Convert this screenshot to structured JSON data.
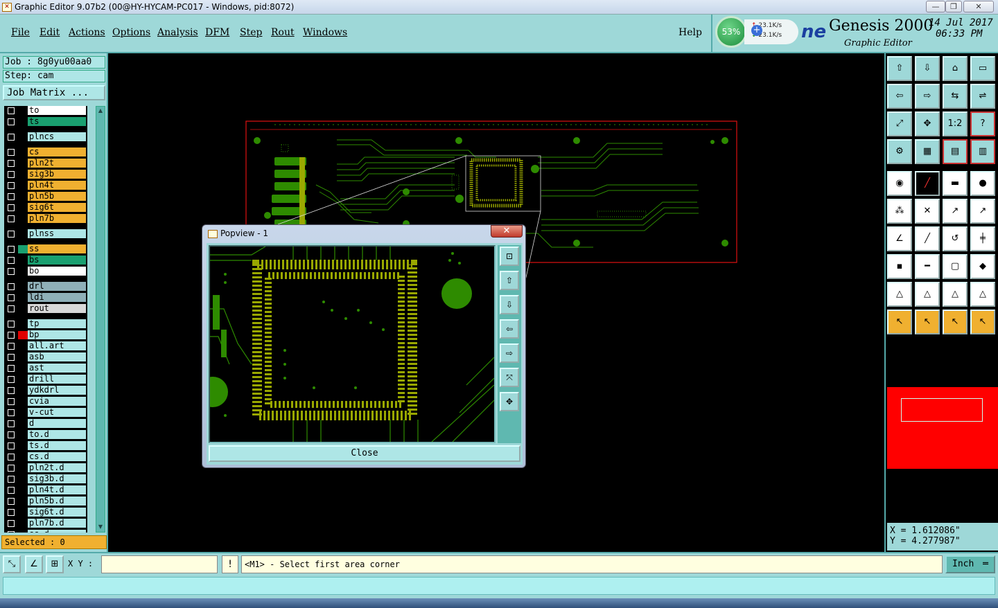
{
  "window": {
    "title": "Graphic Editor 9.07b2 (00@HY-HYCAM-PC017 - Windows, pid:8072)"
  },
  "menu": [
    "File",
    "Edit",
    "Actions",
    "Options",
    "Analysis",
    "DFM",
    "Step",
    "Rout",
    "Windows"
  ],
  "help_label": "Help",
  "brand": {
    "cpu": "53%",
    "net_up": "23.1K/s",
    "net_down": "23.1K/s",
    "logo_fragment": "ne",
    "product": "Genesis 2000",
    "subtitle": "Graphic Editor",
    "date": "14 Jul 2017",
    "time": "06:33 PM"
  },
  "job": {
    "job_line": "Job : 8g0yu00aa0",
    "step_line": "Step: cam",
    "matrix_label": "Job Matrix ..."
  },
  "colors": {
    "panel": "#9ed8d8",
    "board_green": "#2e8b00",
    "pad_olive": "#9aa800",
    "profile_red": "#e01010",
    "layer_orange": "#f0b030"
  },
  "layers": [
    {
      "name": "to",
      "color": "#ffffff"
    },
    {
      "name": "ts",
      "color": "#1aa070"
    },
    {
      "name": "plncs",
      "color": "#aee6e6"
    },
    {
      "name": "cs",
      "color": "#f0b030"
    },
    {
      "name": "pln2t",
      "color": "#f0b030"
    },
    {
      "name": "sig3b",
      "color": "#f0b030"
    },
    {
      "name": "pln4t",
      "color": "#f0b030"
    },
    {
      "name": "pln5b",
      "color": "#f0b030"
    },
    {
      "name": "sig6t",
      "color": "#f0b030"
    },
    {
      "name": "pln7b",
      "color": "#f0b030"
    },
    {
      "name": "plnss",
      "color": "#aee6e6"
    },
    {
      "name": "ss",
      "color": "#f0b030"
    },
    {
      "name": "bs",
      "color": "#1aa070"
    },
    {
      "name": "bo",
      "color": "#ffffff"
    },
    {
      "name": "drl",
      "color": "#8fb0b8"
    },
    {
      "name": "ldi",
      "color": "#8fb0b8"
    },
    {
      "name": "rout",
      "color": "#d8d8d8"
    },
    {
      "name": "tp",
      "color": "#aee6e6"
    },
    {
      "name": "bp",
      "color": "#aee6e6"
    },
    {
      "name": "all.art",
      "color": "#aee6e6"
    },
    {
      "name": "asb",
      "color": "#aee6e6"
    },
    {
      "name": "ast",
      "color": "#aee6e6"
    },
    {
      "name": "drill",
      "color": "#aee6e6"
    },
    {
      "name": "ydkdrl",
      "color": "#aee6e6"
    },
    {
      "name": "cvia",
      "color": "#aee6e6"
    },
    {
      "name": "v-cut",
      "color": "#aee6e6"
    },
    {
      "name": "d",
      "color": "#aee6e6"
    },
    {
      "name": "to.d",
      "color": "#aee6e6"
    },
    {
      "name": "ts.d",
      "color": "#aee6e6"
    },
    {
      "name": "cs.d",
      "color": "#aee6e6"
    },
    {
      "name": "pln2t.d",
      "color": "#aee6e6"
    },
    {
      "name": "sig3b.d",
      "color": "#aee6e6"
    },
    {
      "name": "pln4t.d",
      "color": "#aee6e6"
    },
    {
      "name": "pln5b.d",
      "color": "#aee6e6"
    },
    {
      "name": "sig6t.d",
      "color": "#aee6e6"
    },
    {
      "name": "pln7b.d",
      "color": "#aee6e6"
    },
    {
      "name": "ss.d",
      "color": "#aee6e6"
    }
  ],
  "selected_label": "Selected : 0",
  "popview": {
    "title": "Popview - 1",
    "close_label": "Close"
  },
  "coords": {
    "x": "X = 1.612086\"",
    "y": "Y = 4.277987\""
  },
  "status": {
    "xy_label": "X Y :",
    "xy_value": "",
    "prompt": "<M1> - Select first area corner",
    "units": "Inch"
  },
  "toolbar_icons": [
    "nav-up-icon",
    "nav-down-icon",
    "home-icon",
    "panel-icon",
    "nav-left-icon",
    "nav-right-icon",
    "mirror-icon",
    "swap-icon",
    "zoom-fit-icon",
    "zoom-center-icon",
    "scale-1-2-icon",
    "help-icon",
    "tool-settings-icon",
    "grid-icon",
    "layer-filter-icon",
    "layer-filter2-icon",
    "pad-add-icon",
    "line-add-icon",
    "ruler-icon",
    "circle-icon",
    "node-icon",
    "cross-icon",
    "move-icon",
    "copy-icon",
    "angle-icon",
    "line-edit-icon",
    "arc-icon",
    "align-icon",
    "feature-icon",
    "h-line-icon",
    "box-select-icon",
    "shape-icon",
    "triangle-icon",
    "triangle2-icon",
    "triangle3-icon",
    "triangle4-icon",
    "select-icon",
    "select2-icon",
    "select3-icon",
    "select4-icon"
  ]
}
